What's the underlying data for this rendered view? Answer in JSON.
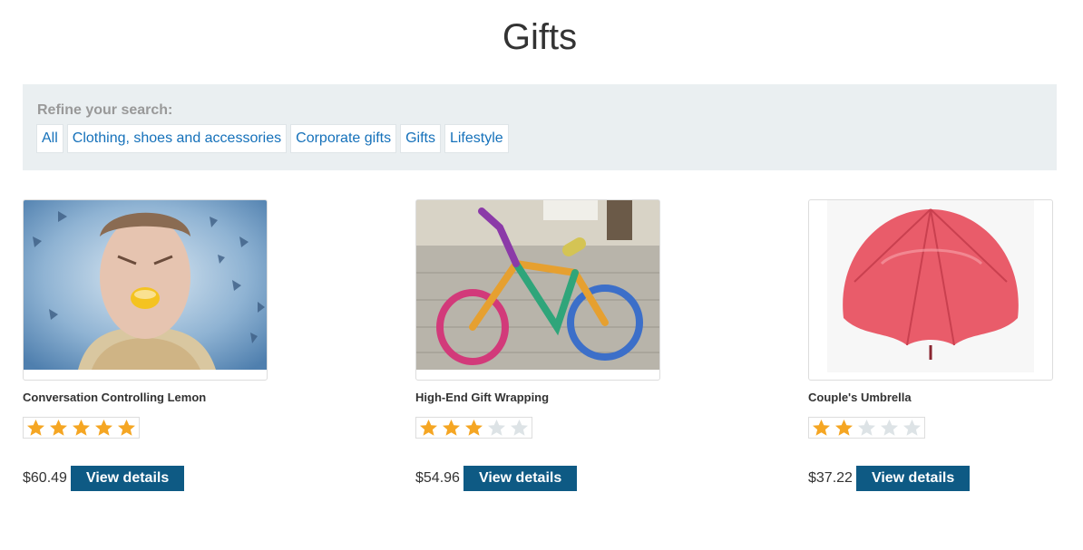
{
  "page": {
    "title": "Gifts"
  },
  "refine": {
    "label": "Refine your search:",
    "filters": [
      "All",
      "Clothing, shoes and accessories",
      "Corporate gifts",
      "Gifts",
      "Lifestyle"
    ]
  },
  "products": [
    {
      "name": "Conversation Controlling Lemon",
      "rating": 5,
      "max_rating": 5,
      "price": "$60.49",
      "button_label": "View details"
    },
    {
      "name": "High-End Gift Wrapping",
      "rating": 3,
      "max_rating": 5,
      "price": "$54.96",
      "button_label": "View details"
    },
    {
      "name": "Couple's Umbrella",
      "rating": 2,
      "max_rating": 5,
      "price": "$37.22",
      "button_label": "View details"
    }
  ],
  "colors": {
    "star_filled": "#f5a623",
    "star_empty": "#dde3e6",
    "button": "#0e5a84",
    "link": "#1571ba"
  }
}
